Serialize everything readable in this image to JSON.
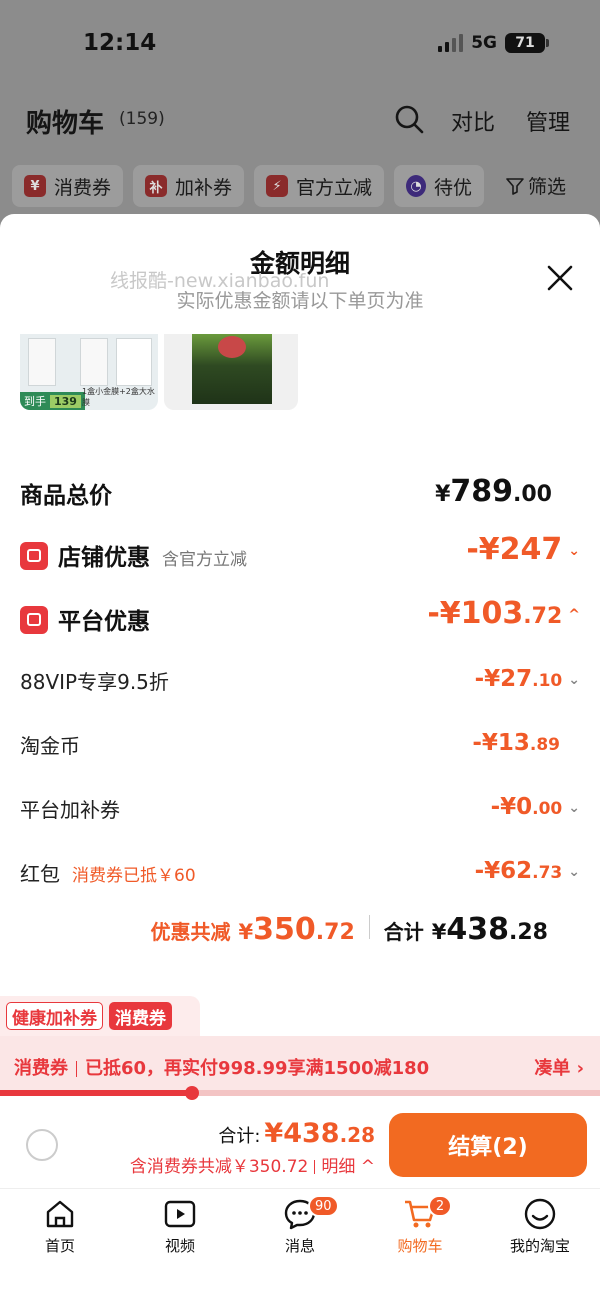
{
  "status_bar": {
    "time": "12:14",
    "network": "5G",
    "battery": "71"
  },
  "cart_header": {
    "title": "购物车",
    "count": "(159)",
    "compare_label": "对比",
    "manage_label": "管理"
  },
  "filters": {
    "chips": [
      {
        "icon": "¥",
        "label": "消费券"
      },
      {
        "icon": "补",
        "label": "加补券"
      },
      {
        "icon": "⚡",
        "label": "官方立减"
      },
      {
        "icon": "◔",
        "label": "待优"
      }
    ],
    "filter_label": "筛选"
  },
  "sheet": {
    "title": "金额明细",
    "subtitle": "实际优惠金额请以下单页为准",
    "watermark": "线报酷-new.xianbao.fun",
    "thumbs": {
      "badge_label": "到手",
      "badge_price": "139",
      "caption": "1盒小金膜+2盒大水膜"
    },
    "goods_total": {
      "label": "商品总价",
      "symbol": "¥",
      "int": "789",
      "dec": ".00"
    },
    "store_discount": {
      "label": "店铺优惠",
      "note": "含官方立减",
      "value": "-¥247",
      "dec": ""
    },
    "platform_discount": {
      "label": "平台优惠",
      "value": "-¥103",
      "dec": ".72"
    },
    "items": [
      {
        "label": "88VIP专享9.5折",
        "note": "",
        "value": "-¥27",
        "dec": ".10",
        "chevron": true
      },
      {
        "label": "淘金币",
        "note": "",
        "value": "-¥13",
        "dec": ".89",
        "chevron": false
      },
      {
        "label": "平台加补券",
        "note": "",
        "value": "-¥0",
        "dec": ".00",
        "chevron": true
      },
      {
        "label": "红包",
        "note": "消费券已抵￥60",
        "value": "-¥62",
        "dec": ".73",
        "chevron": true
      }
    ],
    "summary": {
      "discount_label": "优惠共减",
      "discount_sym": "¥",
      "discount_int": "350",
      "discount_dec": ".72",
      "total_label": "合计",
      "total_sym": "¥",
      "total_int": "438",
      "total_dec": ".28"
    }
  },
  "tags": {
    "tag1": "健康加补券",
    "tag2": "消费券"
  },
  "coupon_bar": {
    "label": "消费券",
    "text": "已抵60，再实付998.99享满1500减180",
    "action": "凑单 ›",
    "progress": 0.32
  },
  "checkout": {
    "total_label": "合计:",
    "total_value": "¥438",
    "total_dec": ".28",
    "discount_text": "含消费券共减￥350.72",
    "detail_label": "明细 ^",
    "button_label": "结算(2)"
  },
  "tabbar": [
    {
      "label": "首页",
      "icon": "home-icon",
      "badge": ""
    },
    {
      "label": "视频",
      "icon": "video-icon",
      "badge": ""
    },
    {
      "label": "消息",
      "icon": "message-icon",
      "badge": "90"
    },
    {
      "label": "购物车",
      "icon": "cart-icon",
      "badge": "2"
    },
    {
      "label": "我的淘宝",
      "icon": "profile-icon",
      "badge": ""
    }
  ],
  "colors": {
    "accent": "#f05a28",
    "red": "#e8383d",
    "button": "#f26a21"
  }
}
